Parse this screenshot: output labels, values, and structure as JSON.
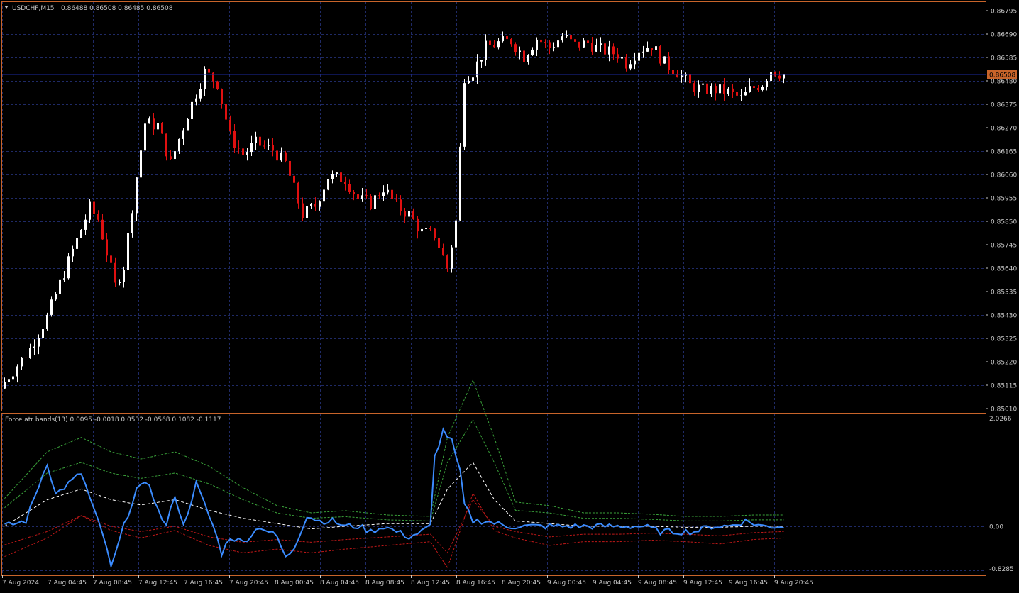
{
  "colors": {
    "background": "#000000",
    "frame": "#c8642a",
    "grid": "#1f2a66",
    "bull_candle": "#ffffff",
    "bear_candle": "#e01010",
    "price_line": "#1c2aa0",
    "price_tag_bg": "#c8642a",
    "axis_text": "#c8c8c8",
    "force_line": "#3b8cff",
    "mid_band": "#ffffff",
    "upper_band": "#3aa23a",
    "lower_band": "#c01818"
  },
  "header": {
    "symbol_label": "USDCHF,M15",
    "ohlc_label": "0.86488 0.86508 0.86485 0.86508",
    "menu_icon": "triangle-down-icon"
  },
  "indicator": {
    "label": "Force atr bands(13) 0.0095 -0.0018 0.0532 -0.0568 0.1082 -0.1117"
  },
  "price_axis": {
    "ticks": [
      "0.86795",
      "0.86690",
      "0.86585",
      "0.86480",
      "0.86375",
      "0.86270",
      "0.86165",
      "0.86060",
      "0.85955",
      "0.85850",
      "0.85745",
      "0.85640",
      "0.85535",
      "0.85430",
      "0.85325",
      "0.85220",
      "0.85115",
      "0.85010"
    ],
    "current_price": "0.86508",
    "ylim": [
      0.8501,
      0.86795
    ]
  },
  "indicator_axis": {
    "ticks": [
      "2.0266",
      "0.00",
      "-0.8285"
    ],
    "ylim": [
      -0.8285,
      2.0266
    ]
  },
  "time_axis": {
    "ticks": [
      "7 Aug 2024",
      "7 Aug 04:45",
      "7 Aug 08:45",
      "7 Aug 12:45",
      "7 Aug 16:45",
      "7 Aug 20:45",
      "8 Aug 00:45",
      "8 Aug 04:45",
      "8 Aug 08:45",
      "8 Aug 12:45",
      "8 Aug 16:45",
      "8 Aug 20:45",
      "9 Aug 00:45",
      "9 Aug 04:45",
      "9 Aug 08:45",
      "9 Aug 12:45",
      "9 Aug 16:45",
      "9 Aug 20:45"
    ]
  },
  "chart_data": [
    {
      "type": "candlestick",
      "title": "USDCHF,M15",
      "bar_count": 184,
      "ylim": [
        0.8501,
        0.86795
      ],
      "close_path": [
        {
          "bar": 0,
          "close": 0.8513
        },
        {
          "bar": 6,
          "close": 0.8528
        },
        {
          "bar": 10,
          "close": 0.8542
        },
        {
          "bar": 16,
          "close": 0.8572
        },
        {
          "bar": 20,
          "close": 0.8591
        },
        {
          "bar": 22,
          "close": 0.8586
        },
        {
          "bar": 26,
          "close": 0.8556
        },
        {
          "bar": 28,
          "close": 0.8565
        },
        {
          "bar": 31,
          "close": 0.8605
        },
        {
          "bar": 33,
          "close": 0.8629
        },
        {
          "bar": 36,
          "close": 0.8628
        },
        {
          "bar": 39,
          "close": 0.8611
        },
        {
          "bar": 43,
          "close": 0.8633
        },
        {
          "bar": 47,
          "close": 0.8652
        },
        {
          "bar": 50,
          "close": 0.8647
        },
        {
          "bar": 53,
          "close": 0.8623
        },
        {
          "bar": 56,
          "close": 0.8615
        },
        {
          "bar": 59,
          "close": 0.862
        },
        {
          "bar": 63,
          "close": 0.8617
        },
        {
          "bar": 66,
          "close": 0.8611
        },
        {
          "bar": 70,
          "close": 0.8588
        },
        {
          "bar": 73,
          "close": 0.8592
        },
        {
          "bar": 76,
          "close": 0.8605
        },
        {
          "bar": 80,
          "close": 0.8604
        },
        {
          "bar": 83,
          "close": 0.8595
        },
        {
          "bar": 86,
          "close": 0.8593
        },
        {
          "bar": 89,
          "close": 0.86
        },
        {
          "bar": 92,
          "close": 0.8592
        },
        {
          "bar": 95,
          "close": 0.8588
        },
        {
          "bar": 98,
          "close": 0.858
        },
        {
          "bar": 101,
          "close": 0.8579
        },
        {
          "bar": 104,
          "close": 0.8564
        },
        {
          "bar": 106,
          "close": 0.8585
        },
        {
          "bar": 108,
          "close": 0.865
        },
        {
          "bar": 110,
          "close": 0.8652
        },
        {
          "bar": 113,
          "close": 0.8663
        },
        {
          "bar": 116,
          "close": 0.8665
        },
        {
          "bar": 119,
          "close": 0.8666
        },
        {
          "bar": 122,
          "close": 0.8659
        },
        {
          "bar": 125,
          "close": 0.8667
        },
        {
          "bar": 128,
          "close": 0.8663
        },
        {
          "bar": 131,
          "close": 0.8668
        },
        {
          "bar": 134,
          "close": 0.8664
        },
        {
          "bar": 137,
          "close": 0.8665
        },
        {
          "bar": 140,
          "close": 0.8662
        },
        {
          "bar": 144,
          "close": 0.866
        },
        {
          "bar": 146,
          "close": 0.8656
        },
        {
          "bar": 149,
          "close": 0.8662
        },
        {
          "bar": 152,
          "close": 0.8664
        },
        {
          "bar": 155,
          "close": 0.8656
        },
        {
          "bar": 158,
          "close": 0.8652
        },
        {
          "bar": 161,
          "close": 0.8646
        },
        {
          "bar": 164,
          "close": 0.8644
        },
        {
          "bar": 167,
          "close": 0.8644
        },
        {
          "bar": 170,
          "close": 0.8643
        },
        {
          "bar": 173,
          "close": 0.864
        },
        {
          "bar": 175,
          "close": 0.8644
        },
        {
          "bar": 178,
          "close": 0.8647
        },
        {
          "bar": 180,
          "close": 0.8653
        },
        {
          "bar": 183,
          "close": 0.86508
        }
      ]
    },
    {
      "type": "line",
      "title": "Force atr bands(13)",
      "ylim": [
        -0.8285,
        2.0266
      ],
      "series": [
        {
          "values": [
            [
              0,
              0.0
            ],
            [
              5,
              0.1
            ],
            [
              10,
              1.2
            ],
            [
              12,
              0.6
            ],
            [
              15,
              0.8
            ],
            [
              18,
              1.0
            ],
            [
              21,
              0.3
            ],
            [
              24,
              -0.4
            ],
            [
              25,
              -0.8
            ],
            [
              28,
              0.0
            ],
            [
              31,
              0.7
            ],
            [
              34,
              0.8
            ],
            [
              36,
              0.3
            ],
            [
              38,
              0.0
            ],
            [
              40,
              0.6
            ],
            [
              42,
              0.0
            ],
            [
              45,
              0.8
            ],
            [
              47,
              0.4
            ],
            [
              49,
              0.0
            ],
            [
              51,
              -0.5
            ],
            [
              53,
              -0.2
            ],
            [
              56,
              -0.3
            ],
            [
              60,
              0.0
            ],
            [
              64,
              -0.2
            ],
            [
              66,
              -0.6
            ],
            [
              68,
              -0.4
            ],
            [
              71,
              0.2
            ],
            [
              74,
              0.1
            ],
            [
              77,
              0.1
            ],
            [
              80,
              0.0
            ],
            [
              83,
              0.0
            ],
            [
              86,
              -0.1
            ],
            [
              89,
              0.0
            ],
            [
              92,
              -0.1
            ],
            [
              95,
              -0.2
            ],
            [
              98,
              -0.1
            ],
            [
              100,
              0.0
            ],
            [
              101,
              1.3
            ],
            [
              103,
              1.8
            ],
            [
              105,
              1.6
            ],
            [
              107,
              1.0
            ],
            [
              108,
              0.4
            ],
            [
              110,
              0.1
            ],
            [
              113,
              0.1
            ],
            [
              118,
              0.0
            ],
            [
              122,
              0.0
            ],
            [
              126,
              0.0
            ],
            [
              130,
              0.0
            ],
            [
              134,
              0.0
            ],
            [
              138,
              0.0
            ],
            [
              142,
              0.0
            ],
            [
              146,
              0.0
            ],
            [
              150,
              0.0
            ],
            [
              154,
              -0.1
            ],
            [
              158,
              -0.1
            ],
            [
              162,
              -0.1
            ],
            [
              166,
              0.0
            ],
            [
              170,
              0.0
            ],
            [
              174,
              0.1
            ],
            [
              178,
              0.0
            ],
            [
              183,
              0.0
            ]
          ]
        },
        {
          "values": [
            [
              0,
              0.0
            ],
            [
              10,
              0.5
            ],
            [
              18,
              0.7
            ],
            [
              25,
              0.5
            ],
            [
              32,
              0.4
            ],
            [
              40,
              0.5
            ],
            [
              48,
              0.3
            ],
            [
              56,
              0.15
            ],
            [
              64,
              0.05
            ],
            [
              72,
              -0.05
            ],
            [
              80,
              0.0
            ],
            [
              90,
              0.05
            ],
            [
              100,
              0.05
            ],
            [
              104,
              0.7
            ],
            [
              110,
              1.2
            ],
            [
              115,
              0.5
            ],
            [
              120,
              0.1
            ],
            [
              128,
              0.05
            ],
            [
              136,
              0.0
            ],
            [
              144,
              0.0
            ],
            [
              152,
              0.0
            ],
            [
              160,
              -0.02
            ],
            [
              168,
              -0.02
            ],
            [
              176,
              0.0
            ],
            [
              183,
              0.0
            ]
          ]
        },
        {
          "values": [
            [
              0,
              0.35
            ],
            [
              10,
              1.0
            ],
            [
              18,
              1.2
            ],
            [
              25,
              1.0
            ],
            [
              32,
              0.9
            ],
            [
              40,
              1.0
            ],
            [
              48,
              0.8
            ],
            [
              56,
              0.5
            ],
            [
              64,
              0.25
            ],
            [
              72,
              0.15
            ],
            [
              80,
              0.18
            ],
            [
              90,
              0.12
            ],
            [
              100,
              0.1
            ],
            [
              104,
              1.2
            ],
            [
              110,
              2.0
            ],
            [
              115,
              1.2
            ],
            [
              120,
              0.3
            ],
            [
              128,
              0.25
            ],
            [
              136,
              0.15
            ],
            [
              144,
              0.15
            ],
            [
              152,
              0.13
            ],
            [
              160,
              0.1
            ],
            [
              168,
              0.1
            ],
            [
              176,
              0.12
            ],
            [
              183,
              0.12
            ]
          ]
        },
        {
          "values": [
            [
              0,
              -0.35
            ],
            [
              10,
              -0.1
            ],
            [
              18,
              0.2
            ],
            [
              25,
              0.0
            ],
            [
              32,
              -0.1
            ],
            [
              40,
              0.0
            ],
            [
              48,
              -0.2
            ],
            [
              56,
              -0.3
            ],
            [
              64,
              -0.25
            ],
            [
              72,
              -0.3
            ],
            [
              80,
              -0.25
            ],
            [
              90,
              -0.2
            ],
            [
              100,
              -0.15
            ],
            [
              104,
              -0.5
            ],
            [
              110,
              0.5
            ],
            [
              115,
              0.0
            ],
            [
              120,
              -0.1
            ],
            [
              128,
              -0.2
            ],
            [
              136,
              -0.15
            ],
            [
              144,
              -0.15
            ],
            [
              152,
              -0.13
            ],
            [
              160,
              -0.15
            ],
            [
              168,
              -0.18
            ],
            [
              176,
              -0.12
            ],
            [
              183,
              -0.1
            ]
          ]
        }
      ]
    }
  ]
}
